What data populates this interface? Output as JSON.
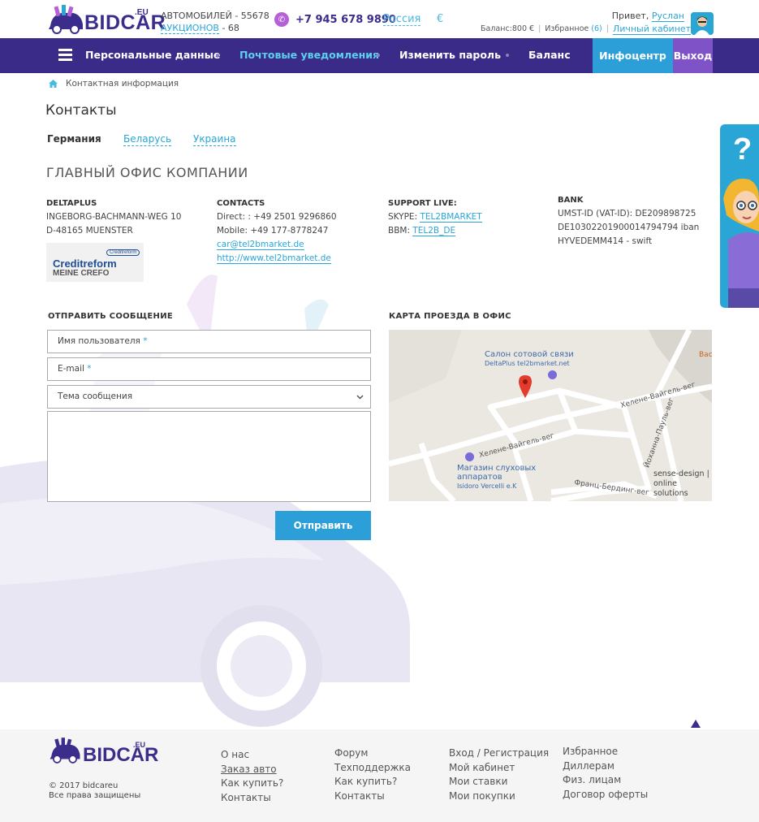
{
  "header": {
    "logo_text": "BIDCAR",
    "logo_suffix": ".EU",
    "cars_label": "АВТОМОБИЛЕЙ - 55678",
    "auctions_link": "АУКЦИОНОВ",
    "auctions_count": " - 68",
    "phone": "+7 945 678 9890",
    "country": "Россия",
    "currency": "€",
    "greeting": "Привет,",
    "user_name": "Руслан",
    "cabinet_link": "Личный кабинет",
    "balance": "Баланс:800 €",
    "favorites": "Избранное",
    "favorites_count": "(6)"
  },
  "nav": {
    "items": [
      {
        "label": "Персональные данные"
      },
      {
        "label": "Почтовые уведомления"
      },
      {
        "label": "Изменить пароль"
      },
      {
        "label": "Баланс"
      }
    ],
    "infocenter": "Инфоцентр",
    "logout": "Выход"
  },
  "breadcrumb": "Контактная информация",
  "page_title": "Контакты",
  "tabs": [
    {
      "label": "Германия"
    },
    {
      "label": "Беларусь"
    },
    {
      "label": "Украина"
    }
  ],
  "office_title": "ГЛАВНЫЙ ОФИС КОМПАНИИ",
  "columns": {
    "company": {
      "head": "DELTAPLUS",
      "line1": "INGEBORG-BACHMANN-WEG 10",
      "line2": "D-48165 MUENSTER"
    },
    "contacts": {
      "head": "CONTACTS",
      "direct": "Direct: : +49 2501 9296860",
      "mobile": "Mobile: +49 177-8778247",
      "email": "car@tel2bmarket.de",
      "site": "http://www.tel2bmarket.de"
    },
    "support": {
      "head": "SUPPORT LIVE:",
      "skype_label": "SKYPE: ",
      "skype": "TEL2BMARKET",
      "bbm_label": "BBM: ",
      "bbm": "TEL2B_DE"
    },
    "bank": {
      "head": "BANK",
      "line1": "UMST-ID (VAT-ID): DE209898725",
      "line2": "DE10302201900014794794 iban",
      "line3": "HYVEDEMM414 - swift"
    }
  },
  "creditreform": {
    "main": "Creditreform",
    "sub": "MEINE CREFO",
    "top": "Creditreform"
  },
  "form": {
    "title": "ОТПРАВИТЬ СООБЩЕНИЕ",
    "username": "Имя пользователя",
    "email": "E-mail",
    "required_mark": "*",
    "subject": "Тема сообщения",
    "submit": "Отправить"
  },
  "map": {
    "title": "КАРТА ПРОЕЗДА В ОФИС",
    "poi1_line1": "Салон сотовой связи",
    "poi1_line2": "DeltaPlus tel2bmarket.net",
    "poi2_line1": "Магазин слуховых",
    "poi2_line2": "аппаратов",
    "poi2_line3": "Isidoro Vercelli e.K",
    "street1": "Хелене-Вайгель-вег",
    "street2": "Хелене-Вайгель-вег",
    "street3": "Йоханна-Пауль-вег",
    "street4": "Франц-Бердинг-вег",
    "poi3_line1": "sense-design |",
    "poi3_line2": "online solutions",
    "poi4": "Back"
  },
  "help_widget": {
    "symbol": "?"
  },
  "footer": {
    "logo_text": "BIDCAR",
    "logo_suffix": ".EU",
    "copy1": "© 2017 bidcareu",
    "copy2": "Все права защищены",
    "col1": [
      "О нас",
      "Заказ авто",
      "Как купить?",
      "Контакты"
    ],
    "col2": [
      "Форум",
      "Техподдержка",
      "Как купить?",
      "Контакты"
    ],
    "col3": [
      "Вход / Регистрация",
      "Мой кабинет",
      "Мои ставки",
      "Мои покупки"
    ],
    "col4": [
      "Избранное",
      "Диллерам",
      "Физ. лицам",
      "Договор оферты"
    ]
  },
  "colors": {
    "nav_bg": "#3b2b88",
    "accent_blue": "#2c9fd8",
    "logout_purple": "#7f53c7",
    "link": "#2aa6d6"
  }
}
